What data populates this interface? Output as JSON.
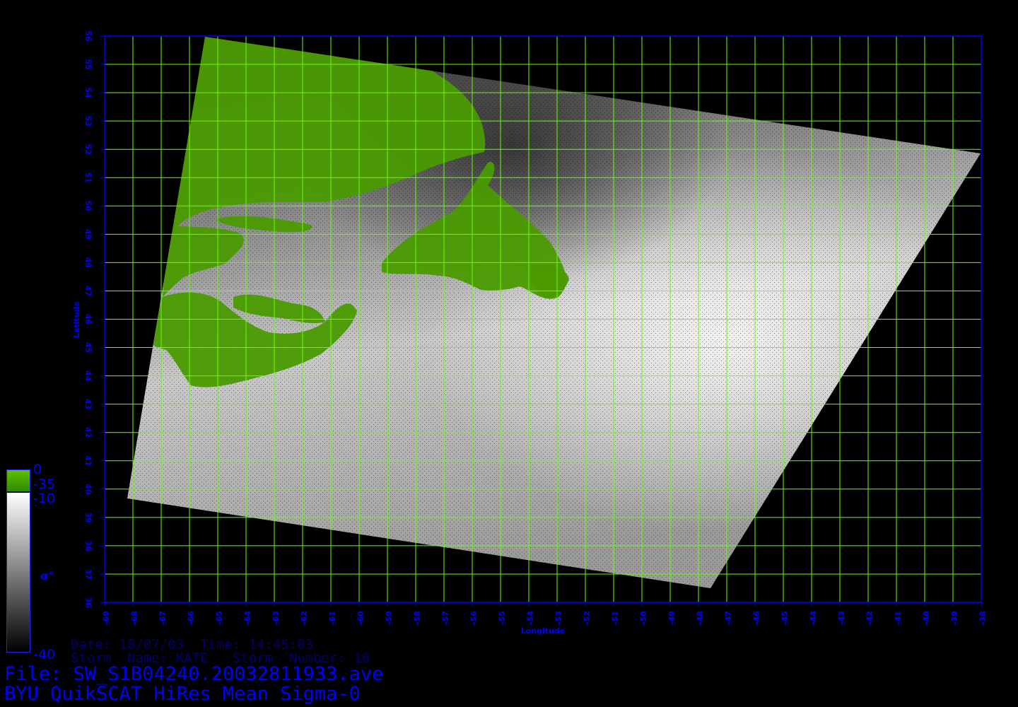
{
  "map": {
    "lon_range": [
      -69,
      -38
    ],
    "lat_range": [
      36,
      56
    ],
    "x_axis_label": "Longitude",
    "y_axis_label": "Latitude",
    "x_ticks": [
      "-69",
      "-68",
      "-67",
      "-66",
      "-65",
      "-64",
      "-63",
      "-62",
      "-61",
      "-60",
      "-59",
      "-58",
      "-57",
      "-56",
      "-55",
      "-54",
      "-53",
      "-52",
      "-51",
      "-50",
      "-49",
      "-48",
      "-47",
      "-46",
      "-45",
      "-44",
      "-43",
      "-42",
      "-41",
      "-40",
      "-39",
      "-38"
    ],
    "y_ticks": [
      "36",
      "37",
      "38",
      "39",
      "40",
      "41",
      "42",
      "43",
      "44",
      "45",
      "46",
      "47",
      "48",
      "49",
      "50",
      "51",
      "52",
      "53",
      "54",
      "55",
      "56"
    ],
    "grid_color": "#66ff00",
    "axis_color": "#0000ff",
    "land_color": "#4a9a00",
    "background_color": "#000000"
  },
  "colorbar": {
    "land_top": "0",
    "land_bottom": "-35",
    "ocean_top": "-10",
    "ocean_bottom": "-40",
    "symbol": "σ°"
  },
  "info": {
    "date_line": "Date: 10/07/03  Time: 14:45:03",
    "storm_line": "Storm  Name: KATE   Storm  Number: 16",
    "file_line": "File: SW_S1B04240.20032811933.ave",
    "title_line": "BYU QuikSCAT HiRes Mean Sigma-0"
  }
}
